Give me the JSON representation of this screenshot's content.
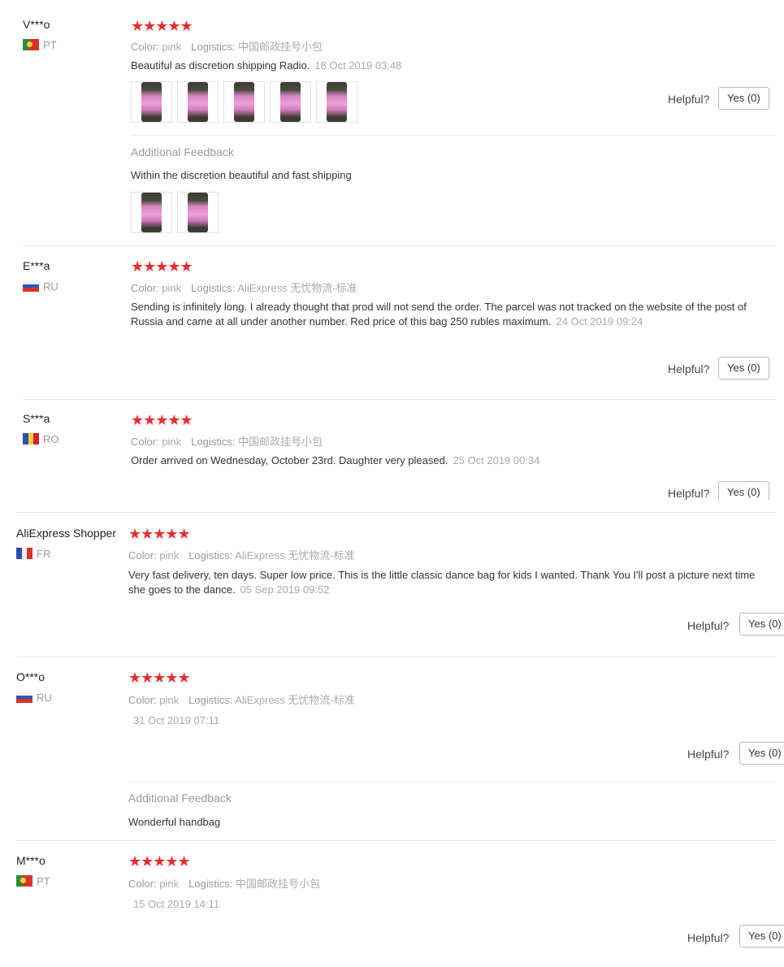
{
  "helpful_label": "Helpful?",
  "colors": {
    "star": "#e62e2e",
    "separator": "#e8e8e8"
  },
  "reviews": [
    {
      "user": "V***o",
      "country": "PT",
      "flag": "flag-portugal-icon",
      "stars": "★★★★★",
      "color_key": "Color:",
      "color_val": "pink",
      "logistics_key": "Logistics:",
      "logistics_val": "中国邮政挂号小包",
      "text": "Beautiful as discretion shipping Radio.",
      "date": "18 Oct 2019 03:48",
      "photos": 5,
      "yes": "Yes (0)",
      "additional_label": "Additional Feedback",
      "additional_text": "Within the discretion beautiful and fast shipping",
      "additional_photos": 2
    },
    {
      "user": "E***a",
      "country": "RU",
      "flag": "flag-russia-icon",
      "stars": "★★★★★",
      "color_key": "Color:",
      "color_val": "pink",
      "logistics_key": "Logistics:",
      "logistics_val": "AliExpress 无忧物流-标准",
      "text": "Sending is infinitely long. I already thought that prod will not send the order. The parcel was not tracked on the website of the post of Russia and came at all under another number. Red price of this bag 250 rubles maximum.",
      "date": "24 Oct 2019 09:24",
      "yes": "Yes (0)"
    },
    {
      "user": "S***a",
      "country": "RO",
      "flag": "flag-romania-icon",
      "stars": "★★★★★",
      "color_key": "Color:",
      "color_val": "pink",
      "logistics_key": "Logistics:",
      "logistics_val": "中国邮政挂号小包",
      "text": "Order arrived on Wednesday, October 23rd. Daughter very pleased.",
      "date": "25 Oct 2019 00:34",
      "yes": "Yes (0)"
    },
    {
      "user": "AliExpress Shopper",
      "country": "FR",
      "flag": "flag-france-icon",
      "stars": "★★★★★",
      "color_key": "Color:",
      "color_val": "pink",
      "logistics_key": "Logistics:",
      "logistics_val": "AliExpress 无忧物流-标准",
      "text": "Very fast delivery, ten days. Super low price. This is the little classic dance bag for kids I wanted. Thank You I'll post a picture next time she goes to the dance.",
      "date": "05 Sep 2019 09:52",
      "yes": "Yes (0)"
    },
    {
      "user": "O***o",
      "country": "RU",
      "flag": "flag-russia-icon",
      "stars": "★★★★★",
      "color_key": "Color:",
      "color_val": "pink",
      "logistics_key": "Logistics:",
      "logistics_val": "AliExpress 无忧物流-标准",
      "date": "31 Oct 2019 07:11",
      "yes": "Yes (0)",
      "additional_label": "Additional Feedback",
      "additional_text": "Wonderful handbag"
    },
    {
      "user": "M***o",
      "country": "PT",
      "flag": "flag-portugal-icon",
      "stars": "★★★★★",
      "color_key": "Color:",
      "color_val": "pink",
      "logistics_key": "Logistics:",
      "logistics_val": "中国邮政挂号小包",
      "date": "15 Oct 2019 14:11",
      "yes": "Yes (0)"
    }
  ]
}
